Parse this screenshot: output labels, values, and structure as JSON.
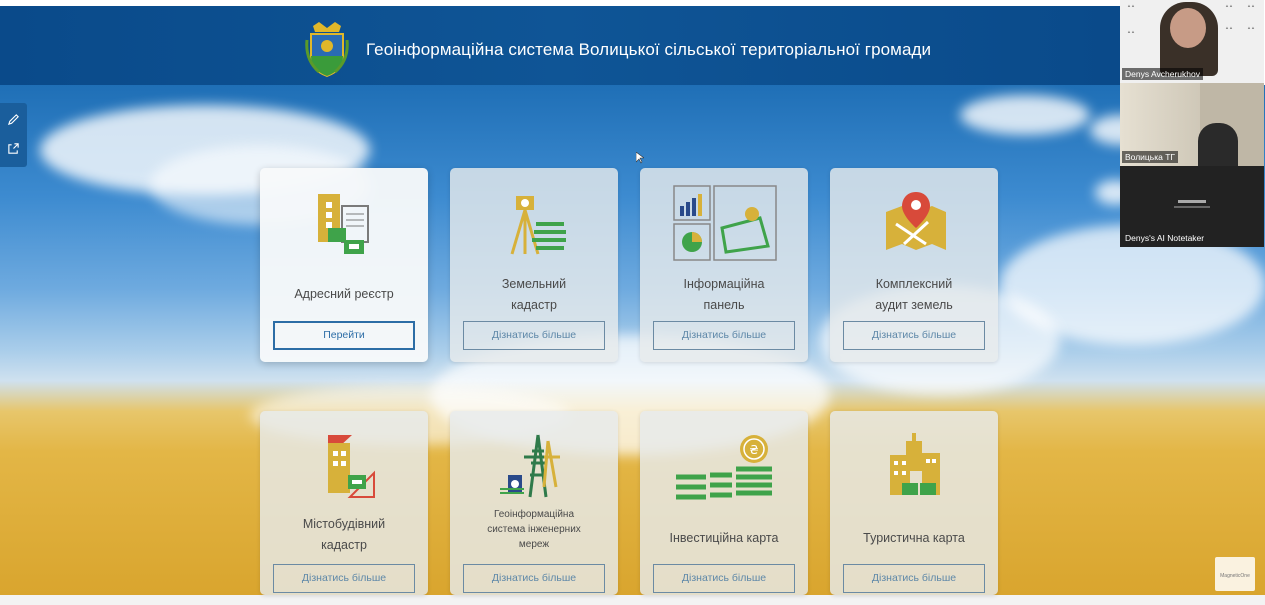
{
  "header": {
    "title": "Геоінформаційна система Волицької сільської територіальної громади",
    "crest_icon": "coat-of-arms-icon"
  },
  "side_tools": [
    {
      "icon": "pencil-icon"
    },
    {
      "icon": "share-icon"
    }
  ],
  "cards": [
    {
      "title": [
        "Адресний реєстр"
      ],
      "button": "Перейти",
      "icon": "address-registry-icon",
      "active": true
    },
    {
      "title": [
        "Земельний",
        "кадастр"
      ],
      "button": "Дізнатись більше",
      "icon": "land-cadastre-icon"
    },
    {
      "title": [
        "Інформаційна",
        "панель"
      ],
      "button": "Дізнатись більше",
      "icon": "dashboard-icon"
    },
    {
      "title": [
        "Комплексний",
        "аудит земель"
      ],
      "button": "Дізнатись більше",
      "icon": "land-audit-icon"
    },
    {
      "title": [
        "Містобудівний",
        "кадастр"
      ],
      "button": "Дізнатись більше",
      "icon": "urban-cadastre-icon"
    },
    {
      "title": [
        "Геоінформаційна",
        "система інженерних",
        "мереж"
      ],
      "button": "Дізнатись більше",
      "icon": "engineering-networks-icon"
    },
    {
      "title": [
        "Інвестиційна карта"
      ],
      "button": "Дізнатись більше",
      "icon": "investment-map-icon"
    },
    {
      "title": [
        "Туристична карта"
      ],
      "button": "Дізнатись більше",
      "icon": "tourist-map-icon"
    }
  ],
  "participants": [
    {
      "name": "Denys Avcherukhov"
    },
    {
      "name": "Волицька ТГ"
    },
    {
      "name": "Denys's AI Notetaker"
    }
  ],
  "watermark": "MagneticOne"
}
